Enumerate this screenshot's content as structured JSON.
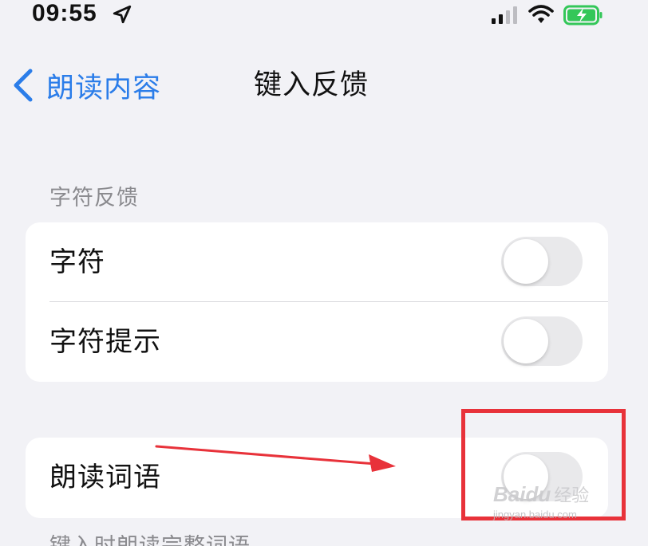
{
  "status_bar": {
    "time": "09:55",
    "icons": [
      "location-arrow-icon",
      "cellular-signal-icon",
      "wifi-icon",
      "battery-charging-icon"
    ],
    "battery_color": "#34c759"
  },
  "nav": {
    "back_label": "朗读内容",
    "title": "键入反馈",
    "accent_color": "#2b7de9"
  },
  "sections": [
    {
      "header": "字符反馈",
      "rows": [
        {
          "label": "字符",
          "toggle_on": false
        },
        {
          "label": "字符提示",
          "toggle_on": false
        }
      ]
    },
    {
      "header": "",
      "rows": [
        {
          "label": "朗读词语",
          "toggle_on": false
        }
      ],
      "footer": "键入时朗读完整词语"
    }
  ],
  "annotation": {
    "color": "#e8323a"
  },
  "watermark": {
    "logo": "Baidu",
    "text": "经验",
    "url": "jingyan.baidu.com"
  }
}
